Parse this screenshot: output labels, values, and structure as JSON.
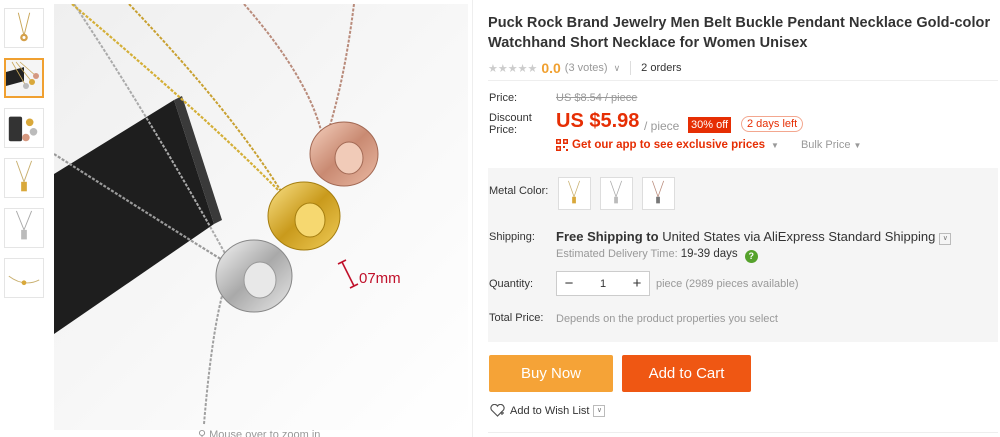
{
  "gallery": {
    "thumbs": [
      {
        "name": "thumb-1"
      },
      {
        "name": "thumb-2",
        "active": true
      },
      {
        "name": "thumb-3"
      },
      {
        "name": "thumb-4"
      },
      {
        "name": "thumb-5"
      },
      {
        "name": "thumb-6"
      }
    ],
    "main_image_label": "07mm",
    "zoom_hint": "Mouse over to zoom in"
  },
  "product": {
    "title": "Puck Rock Brand Jewelry Men Belt Buckle Pendant Necklace Gold-color Watchhand Short Necklace for Women Unisex",
    "rating": "0.0",
    "votes": "(3 votes)",
    "orders": "2 orders"
  },
  "price": {
    "price_label": "Price:",
    "old_price": "US $8.54 / piece",
    "discount_label_1": "Discount",
    "discount_label_2": "Price:",
    "new_price": "US $5.98",
    "per_piece": "/ piece",
    "off_badge": "30% off",
    "days_left": "2 days left",
    "app_link": "Get our app to see exclusive prices",
    "bulk_price": "Bulk Price"
  },
  "options": {
    "metal_label": "Metal Color:",
    "metal_colors": [
      "gold",
      "silver",
      "rose-gold"
    ]
  },
  "shipping": {
    "label": "Shipping:",
    "free": "Free Shipping to",
    "destination": "United States via AliExpress Standard Shipping",
    "estimated_label": "Estimated Delivery Time:",
    "days": "19-39 days"
  },
  "quantity": {
    "label": "Quantity:",
    "value": "1",
    "note": "piece (2989 pieces available)"
  },
  "total": {
    "label": "Total Price:",
    "value": "Depends on the product properties you select"
  },
  "actions": {
    "buy_now": "Buy Now",
    "add_to_cart": "Add to Cart",
    "wishlist": "Add to Wish List"
  },
  "colors": {
    "accent_red": "#e62e04",
    "buy_orange": "#f5a337",
    "cart_orange": "#ef5713",
    "rating_orange": "#f0a030"
  }
}
